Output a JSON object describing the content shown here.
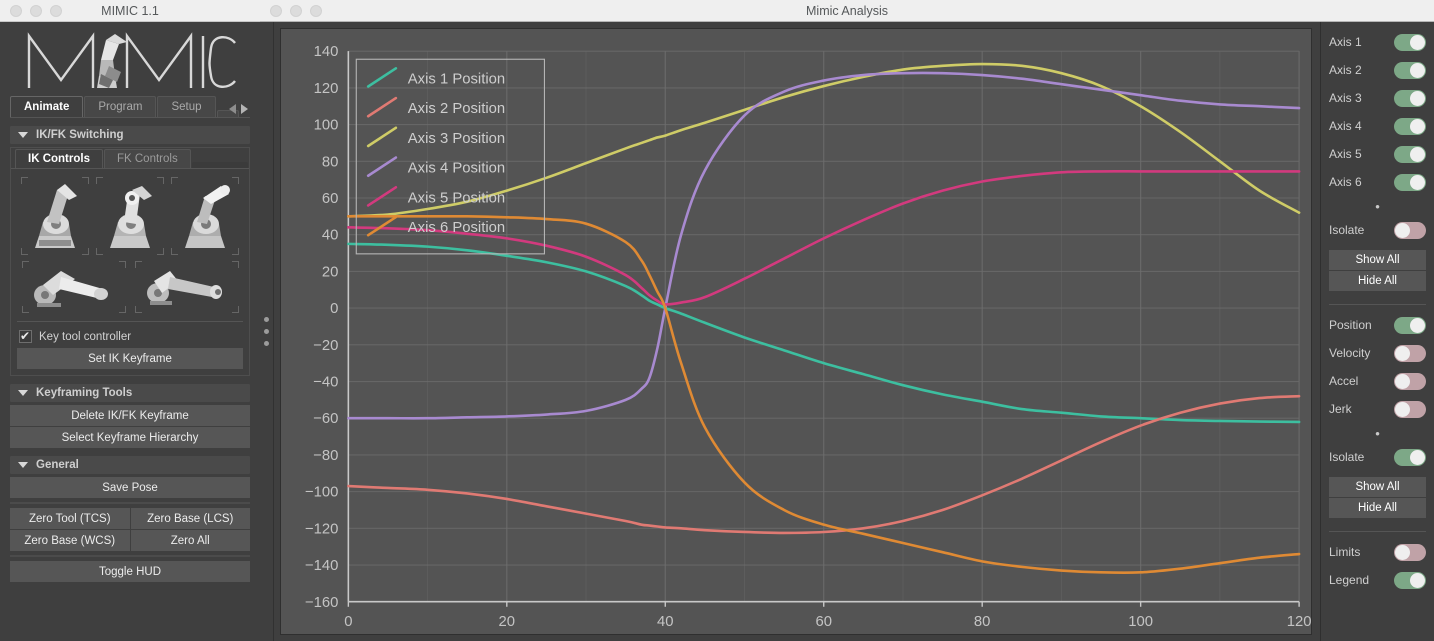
{
  "left_window": {
    "title": "MIMIC 1.1",
    "logo_text": "MIMIC",
    "tabs": [
      {
        "label": "Animate",
        "active": true
      },
      {
        "label": "Program",
        "active": false
      },
      {
        "label": "Setup",
        "active": false
      }
    ],
    "nav_prev_icon": "chevron-left-icon",
    "nav_next_icon": "chevron-right-icon",
    "sections": [
      {
        "title": "IK/FK Switching"
      },
      {
        "title": "Keyframing Tools"
      },
      {
        "title": "General"
      }
    ],
    "ikfk": {
      "subtabs": [
        {
          "label": "IK Controls",
          "active": true
        },
        {
          "label": "FK Controls",
          "active": false
        }
      ],
      "checkbox_label": "Key tool controller",
      "checkbox_checked": true,
      "set_keyframe_label": "Set IK Keyframe"
    },
    "keyframing_tools": {
      "buttons": [
        "Delete IK/FK Keyframe",
        "Select Keyframe Hierarchy"
      ]
    },
    "general": {
      "save_pose_label": "Save Pose",
      "zero_buttons": [
        "Zero Tool (TCS)",
        "Zero Base (LCS)",
        "Zero Base (WCS)",
        "Zero All"
      ],
      "toggle_hud_label": "Toggle HUD"
    }
  },
  "right_window": {
    "title": "Mimic Analysis",
    "splitter_icon": "splitter-dots-icon",
    "axis_toggles": [
      {
        "label": "Axis 1",
        "state": "on"
      },
      {
        "label": "Axis 2",
        "state": "on"
      },
      {
        "label": "Axis 3",
        "state": "on"
      },
      {
        "label": "Axis 4",
        "state": "on"
      },
      {
        "label": "Axis 5",
        "state": "on"
      },
      {
        "label": "Axis 6",
        "state": "on"
      }
    ],
    "axis_isolate": {
      "label": "Isolate",
      "state": "off"
    },
    "axis_show_all": "Show All",
    "axis_hide_all": "Hide All",
    "derivative_toggles": [
      {
        "label": "Position",
        "state": "on"
      },
      {
        "label": "Velocity",
        "state": "off"
      },
      {
        "label": "Accel",
        "state": "off"
      },
      {
        "label": "Jerk",
        "state": "off"
      }
    ],
    "derivative_isolate": {
      "label": "Isolate",
      "state": "on"
    },
    "deriv_show_all": "Show All",
    "deriv_hide_all": "Hide All",
    "display_toggles": [
      {
        "label": "Limits",
        "state": "off"
      },
      {
        "label": "Legend",
        "state": "on"
      }
    ],
    "dot_marker": "•"
  },
  "colors": {
    "axis1": "#3dbfa0",
    "axis2": "#e07a73",
    "axis3": "#cfcc67",
    "axis4": "#a88ad0",
    "axis5": "#d23a7e",
    "axis6": "#df8a34",
    "toggle_on": "#7da887",
    "toggle_off": "#c0a2a7",
    "plot_bg": "#545454",
    "grid": "#6d6d6d",
    "panel_bg": "#3f3f3f"
  },
  "chart_data": {
    "type": "line",
    "title": "",
    "xlabel": "",
    "ylabel": "",
    "xlim": [
      0,
      120
    ],
    "ylim": [
      -160,
      140
    ],
    "xticks": [
      0,
      20,
      40,
      60,
      80,
      100,
      120
    ],
    "yticks": [
      140,
      120,
      100,
      80,
      60,
      40,
      20,
      0,
      -20,
      -40,
      -60,
      -80,
      -100,
      -120,
      -140,
      -160
    ],
    "grid": true,
    "legend_position": "top-left",
    "x": [
      0,
      5,
      10,
      15,
      20,
      25,
      30,
      35,
      37,
      38,
      39,
      40,
      42,
      45,
      50,
      55,
      60,
      65,
      70,
      75,
      80,
      85,
      90,
      95,
      100,
      105,
      110,
      115,
      120
    ],
    "series": [
      {
        "name": "Axis 1 Position",
        "color": "#3dbfa0",
        "values": [
          35,
          34.5,
          33.5,
          31.5,
          28.5,
          25,
          20,
          12,
          7,
          4,
          2,
          0,
          -3,
          -8,
          -16,
          -23,
          -30,
          -36,
          -42,
          -47,
          -51,
          -55,
          -57,
          -59,
          -60,
          -61,
          -61.5,
          -61.8,
          -62
        ]
      },
      {
        "name": "Axis 2 Position",
        "color": "#e07a73",
        "values": [
          -97,
          -98,
          -99,
          -101,
          -104,
          -108,
          -112,
          -116,
          -118,
          -118.5,
          -119,
          -119.5,
          -120,
          -121,
          -122,
          -122.5,
          -122,
          -120,
          -116,
          -110,
          -102,
          -93,
          -83,
          -73,
          -64,
          -57,
          -52,
          -49,
          -48
        ]
      },
      {
        "name": "Axis 3 Position",
        "color": "#cfcc67",
        "values": [
          50,
          51,
          54,
          58,
          64,
          71,
          79,
          87,
          90,
          91.5,
          93,
          94,
          97,
          101,
          108,
          115,
          121,
          126,
          130,
          132,
          133,
          132,
          128,
          121,
          110,
          96,
          80,
          64,
          52
        ]
      },
      {
        "name": "Axis 4 Position",
        "color": "#a88ad0",
        "values": [
          -60,
          -60,
          -60,
          -59.5,
          -59,
          -58,
          -56,
          -50,
          -44,
          -38,
          -22,
          0,
          40,
          75,
          105,
          118,
          124,
          127,
          128,
          128,
          127,
          125,
          122,
          119,
          116,
          113,
          111,
          110,
          109
        ]
      },
      {
        "name": "Axis 5 Position",
        "color": "#d23a7e",
        "values": [
          44,
          43.5,
          42.5,
          40.5,
          38,
          34,
          28,
          18,
          11,
          7,
          4,
          2,
          3,
          6,
          16,
          27,
          38,
          48,
          57,
          64,
          69,
          72,
          74,
          74.5,
          74.5,
          74.5,
          74.5,
          74.5,
          74.5
        ]
      },
      {
        "name": "Axis 6 Position",
        "color": "#df8a34",
        "values": [
          50,
          50,
          50,
          50,
          49.5,
          48.5,
          46,
          36,
          26,
          18,
          9,
          0,
          -30,
          -65,
          -95,
          -110,
          -118,
          -123,
          -128,
          -133,
          -138,
          -141,
          -143,
          -144,
          -144,
          -142,
          -139,
          -136,
          -134
        ]
      }
    ]
  }
}
